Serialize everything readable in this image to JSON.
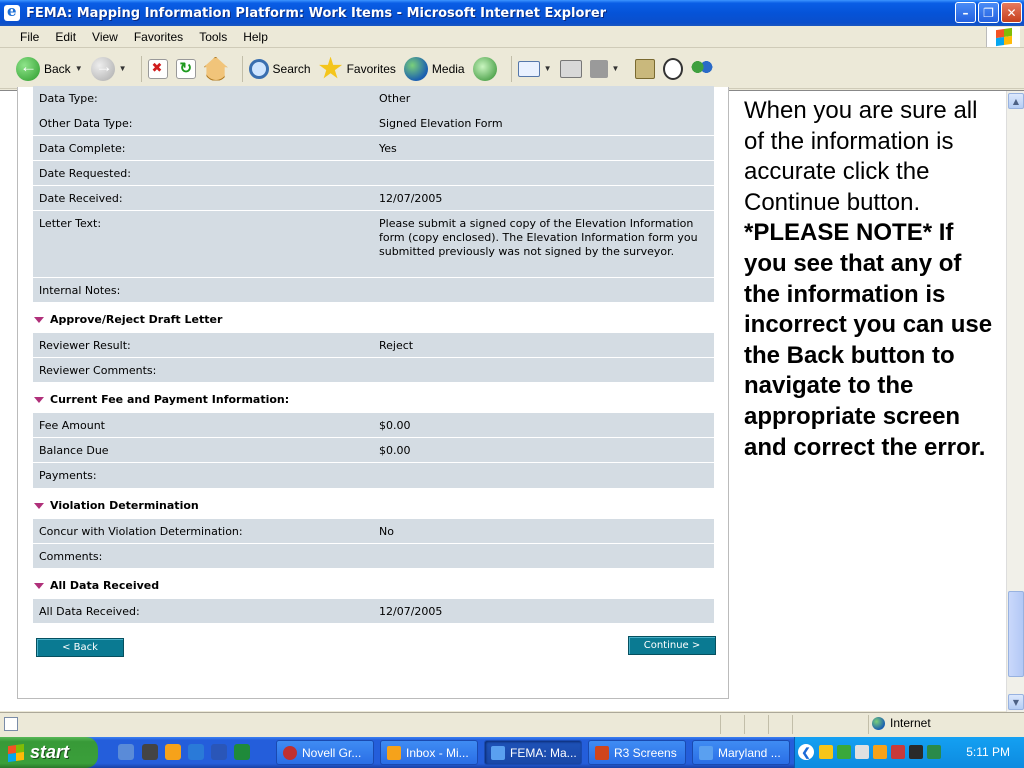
{
  "window": {
    "title": "FEMA: Mapping Information Platform: Work Items - Microsoft Internet Explorer"
  },
  "menu": [
    "File",
    "Edit",
    "View",
    "Favorites",
    "Tools",
    "Help"
  ],
  "toolbar": {
    "back_label": "Back",
    "search_label": "Search",
    "favorites_label": "Favorites",
    "media_label": "Media"
  },
  "details_rows": [
    {
      "label": "Data Type:",
      "value": "Other"
    },
    {
      "label": "Other Data Type:",
      "value": "Signed Elevation Form"
    },
    {
      "label": "Data Complete:",
      "value": "Yes"
    },
    {
      "label": "Date Requested:",
      "value": ""
    },
    {
      "label": "Date Received:",
      "value": "12/07/2005"
    },
    {
      "label": "Letter Text:",
      "value": "Please submit a signed copy of the Elevation Information form (copy enclosed). The Elevation Information form you submitted previously was not signed by the surveyor."
    },
    {
      "label": "Internal Notes:",
      "value": ""
    }
  ],
  "sections": {
    "approve": {
      "title": "Approve/Reject Draft Letter",
      "rows": [
        {
          "label": "Reviewer Result:",
          "value": "Reject"
        },
        {
          "label": "Reviewer Comments:",
          "value": ""
        }
      ]
    },
    "fee": {
      "title": "Current Fee and Payment Information:",
      "rows": [
        {
          "label": "Fee Amount",
          "value": "$0.00"
        },
        {
          "label": "Balance Due",
          "value": "$0.00"
        },
        {
          "label": "Payments:",
          "value": ""
        }
      ]
    },
    "violation": {
      "title": "Violation Determination",
      "rows": [
        {
          "label": "Concur with Violation Determination:",
          "value": "No"
        },
        {
          "label": "Comments:",
          "value": ""
        }
      ]
    },
    "all_data": {
      "title": "All Data Received",
      "rows": [
        {
          "label": "All Data Received:",
          "value": "12/07/2005"
        }
      ]
    }
  },
  "buttons": {
    "back": "< Back",
    "continue": "Continue >"
  },
  "note": {
    "intro": "When you are sure all of the information is accurate click the Continue button.",
    "emphasis": "*PLEASE NOTE* If you see that any of the information is incorrect you can use the Back button to navigate to the appropriate screen and correct the error."
  },
  "status": {
    "zone": "Internet"
  },
  "taskbar": {
    "start": "start",
    "tasks": [
      "Novell Gr...",
      "Inbox - Mi...",
      "FEMA: Ma...",
      "R3 Screens",
      "Maryland ..."
    ],
    "clock": "5:11 PM"
  },
  "colors": {
    "row_bg": "#d4dce3",
    "button_bg": "#0a7a92",
    "section_marker": "#b0307a"
  }
}
